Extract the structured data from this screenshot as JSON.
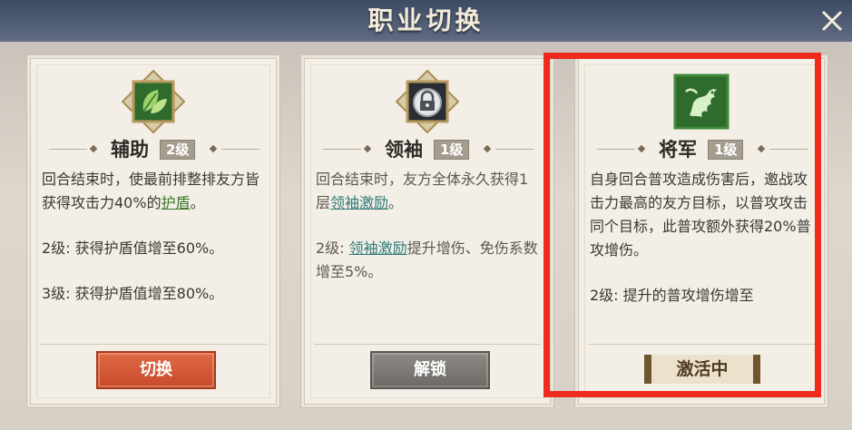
{
  "window": {
    "title": "职业切换",
    "close_icon": "close-icon"
  },
  "colors": {
    "highlight_border": "#ee2b1d",
    "switch_button": "#d45a38",
    "unlock_button": "#7d7a76",
    "link_teal": "#2f7a78",
    "link_green": "#3d7a2d"
  },
  "cards": [
    {
      "icon": "leaf-icon",
      "name": "辅助",
      "level": "2级",
      "desc": {
        "p1_before": "回合结束时，使最前排整排友方皆获得攻击力40%的",
        "p1_link": "护盾",
        "p1_after": "。",
        "p2": "2级: 获得护盾值增至60%。",
        "p3": "3级: 获得护盾值增至80%。"
      },
      "button_label": "切换"
    },
    {
      "icon": "lock-icon",
      "name": "领袖",
      "level": "1级",
      "desc": {
        "p1_before": "回合结束时，友方全体永久获得1层",
        "p1_link": "领袖激励",
        "p1_after": "。",
        "p2_before": "2级: ",
        "p2_link": "领袖激励",
        "p2_after": "提升增伤、免伤系数增至5%。"
      },
      "button_label": "解锁"
    },
    {
      "icon": "dragon-icon",
      "name": "将军",
      "level": "1级",
      "desc": {
        "p1": "自身回合普攻造成伤害后，邀战攻击力最高的友方目标，以普攻攻击同个目标，此普攻额外获得20%普攻增伤。",
        "p2": "2级: 提升的普攻增伤增至"
      },
      "status_label": "激活中"
    }
  ]
}
